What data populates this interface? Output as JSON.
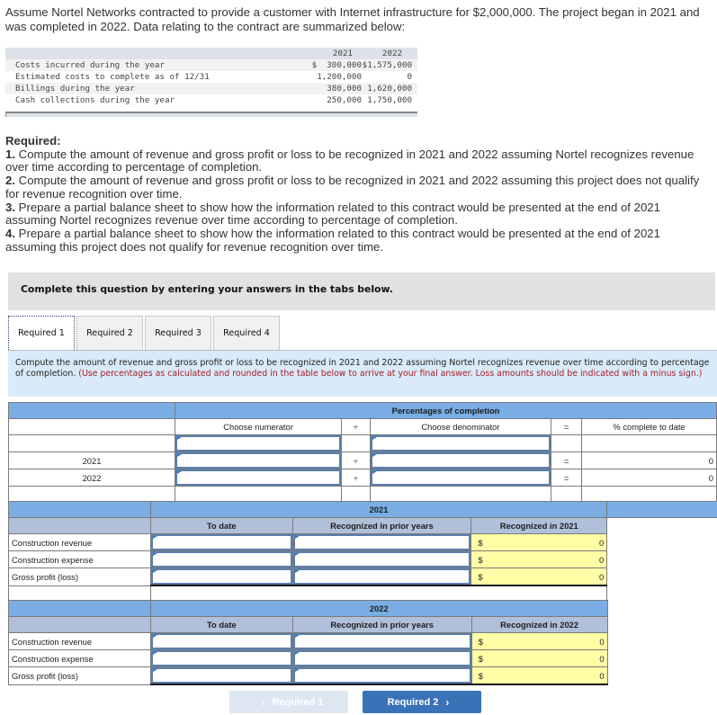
{
  "intro": "Assume Nortel Networks contracted to provide a customer with Internet infrastructure for $2,000,000. The project began in 2021 and was completed in 2022. Data relating to the contract are summarized below:",
  "contract_data": {
    "headers": [
      "",
      "2021",
      "2022"
    ],
    "rows": [
      {
        "label": "Costs incurred during the year",
        "y2021": "$  300,000",
        "y2022": "$1,575,000"
      },
      {
        "label": "Estimated costs to complete as of 12/31",
        "y2021": "1,200,000",
        "y2022": "0"
      },
      {
        "label": "Billings during the year",
        "y2021": "380,000",
        "y2022": "1,620,000"
      },
      {
        "label": "Cash collections during the year",
        "y2021": "250,000",
        "y2022": "1,750,000"
      }
    ]
  },
  "required": {
    "title": "Required:",
    "items": [
      {
        "num": "1.",
        "text": " Compute the amount of revenue and gross profit or loss to be recognized in 2021 and 2022 assuming Nortel recognizes revenue over time according to percentage of completion."
      },
      {
        "num": "2.",
        "text": " Compute the amount of revenue and gross profit or loss to be recognized in 2021 and 2022 assuming this project does not qualify for revenue recognition over time."
      },
      {
        "num": "3.",
        "text": " Prepare a partial balance sheet to show how the information related to this contract would be presented at the end of 2021 assuming Nortel recognizes revenue over time according to percentage of completion."
      },
      {
        "num": "4.",
        "text": " Prepare a partial balance sheet to show how the information related to this contract would be presented at the end of 2021 assuming this project does not qualify for revenue recognition over time."
      }
    ]
  },
  "complete_banner": "Complete this question by entering your answers in the tabs below.",
  "tabs": [
    {
      "label": "Required 1",
      "active": true
    },
    {
      "label": "Required 2",
      "active": false
    },
    {
      "label": "Required 3",
      "active": false
    },
    {
      "label": "Required 4",
      "active": false
    }
  ],
  "instructions": {
    "main": "Compute the amount of revenue and gross profit or loss to be recognized in 2021 and 2022 assuming Nortel recognizes revenue over time according to percentage of completion. ",
    "note": "(Use percentages as calculated and rounded in the table below to arrive at your final answer. Loss amounts should be indicated with a minus sign.)"
  },
  "pct_table": {
    "title": "Percentages of completion",
    "numerator_header": "Choose numerator",
    "divide_symbol": "÷",
    "denominator_header": "Choose denominator",
    "equals_symbol": "=",
    "result_header": "% complete to date",
    "rows": [
      {
        "year": "",
        "numerator": "",
        "denominator": "",
        "show_ops": false,
        "result": ""
      },
      {
        "year": "2021",
        "numerator": "",
        "denominator": "",
        "show_ops": true,
        "result": "0"
      },
      {
        "year": "2022",
        "numerator": "",
        "denominator": "",
        "show_ops": true,
        "result": "0"
      }
    ]
  },
  "year_tables": [
    {
      "year": "2021",
      "to_date_header": "To date",
      "prior_header": "Recognized in prior years",
      "current_header": "Recognized in 2021",
      "rows": [
        {
          "label": "Construction revenue",
          "to_date": "",
          "prior": "",
          "currency": "$",
          "current": "0"
        },
        {
          "label": "Construction expense",
          "to_date": "",
          "prior": "",
          "currency": "$",
          "current": "0"
        },
        {
          "label": "Gross profit (loss)",
          "to_date": "",
          "prior": "",
          "currency": "$",
          "current": "0"
        }
      ]
    },
    {
      "year": "2022",
      "to_date_header": "To date",
      "prior_header": "Recognized in prior years",
      "current_header": "Recognized in 2022",
      "rows": [
        {
          "label": "Construction revenue",
          "to_date": "",
          "prior": "",
          "currency": "$",
          "current": "0"
        },
        {
          "label": "Construction expense",
          "to_date": "",
          "prior": "",
          "currency": "$",
          "current": "0"
        },
        {
          "label": "Gross profit (loss)",
          "to_date": "",
          "prior": "",
          "currency": "$",
          "current": "0"
        }
      ]
    }
  ],
  "navigation": {
    "prev_label": "Required 1",
    "prev_icon": "chevron-left-icon",
    "prev_glyph": "‹",
    "next_label": "Required 2",
    "next_icon": "chevron-right-icon",
    "next_glyph": "›"
  },
  "colors": {
    "band_blue": "#79ade4",
    "subheader_blue": "#b1c0da",
    "computed_yellow": "#fffea7",
    "instruction_bg": "#d9eaf8",
    "note_red": "#a5202a",
    "next_button": "#3a72b7",
    "prev_button_disabled": "#dde7f2"
  }
}
